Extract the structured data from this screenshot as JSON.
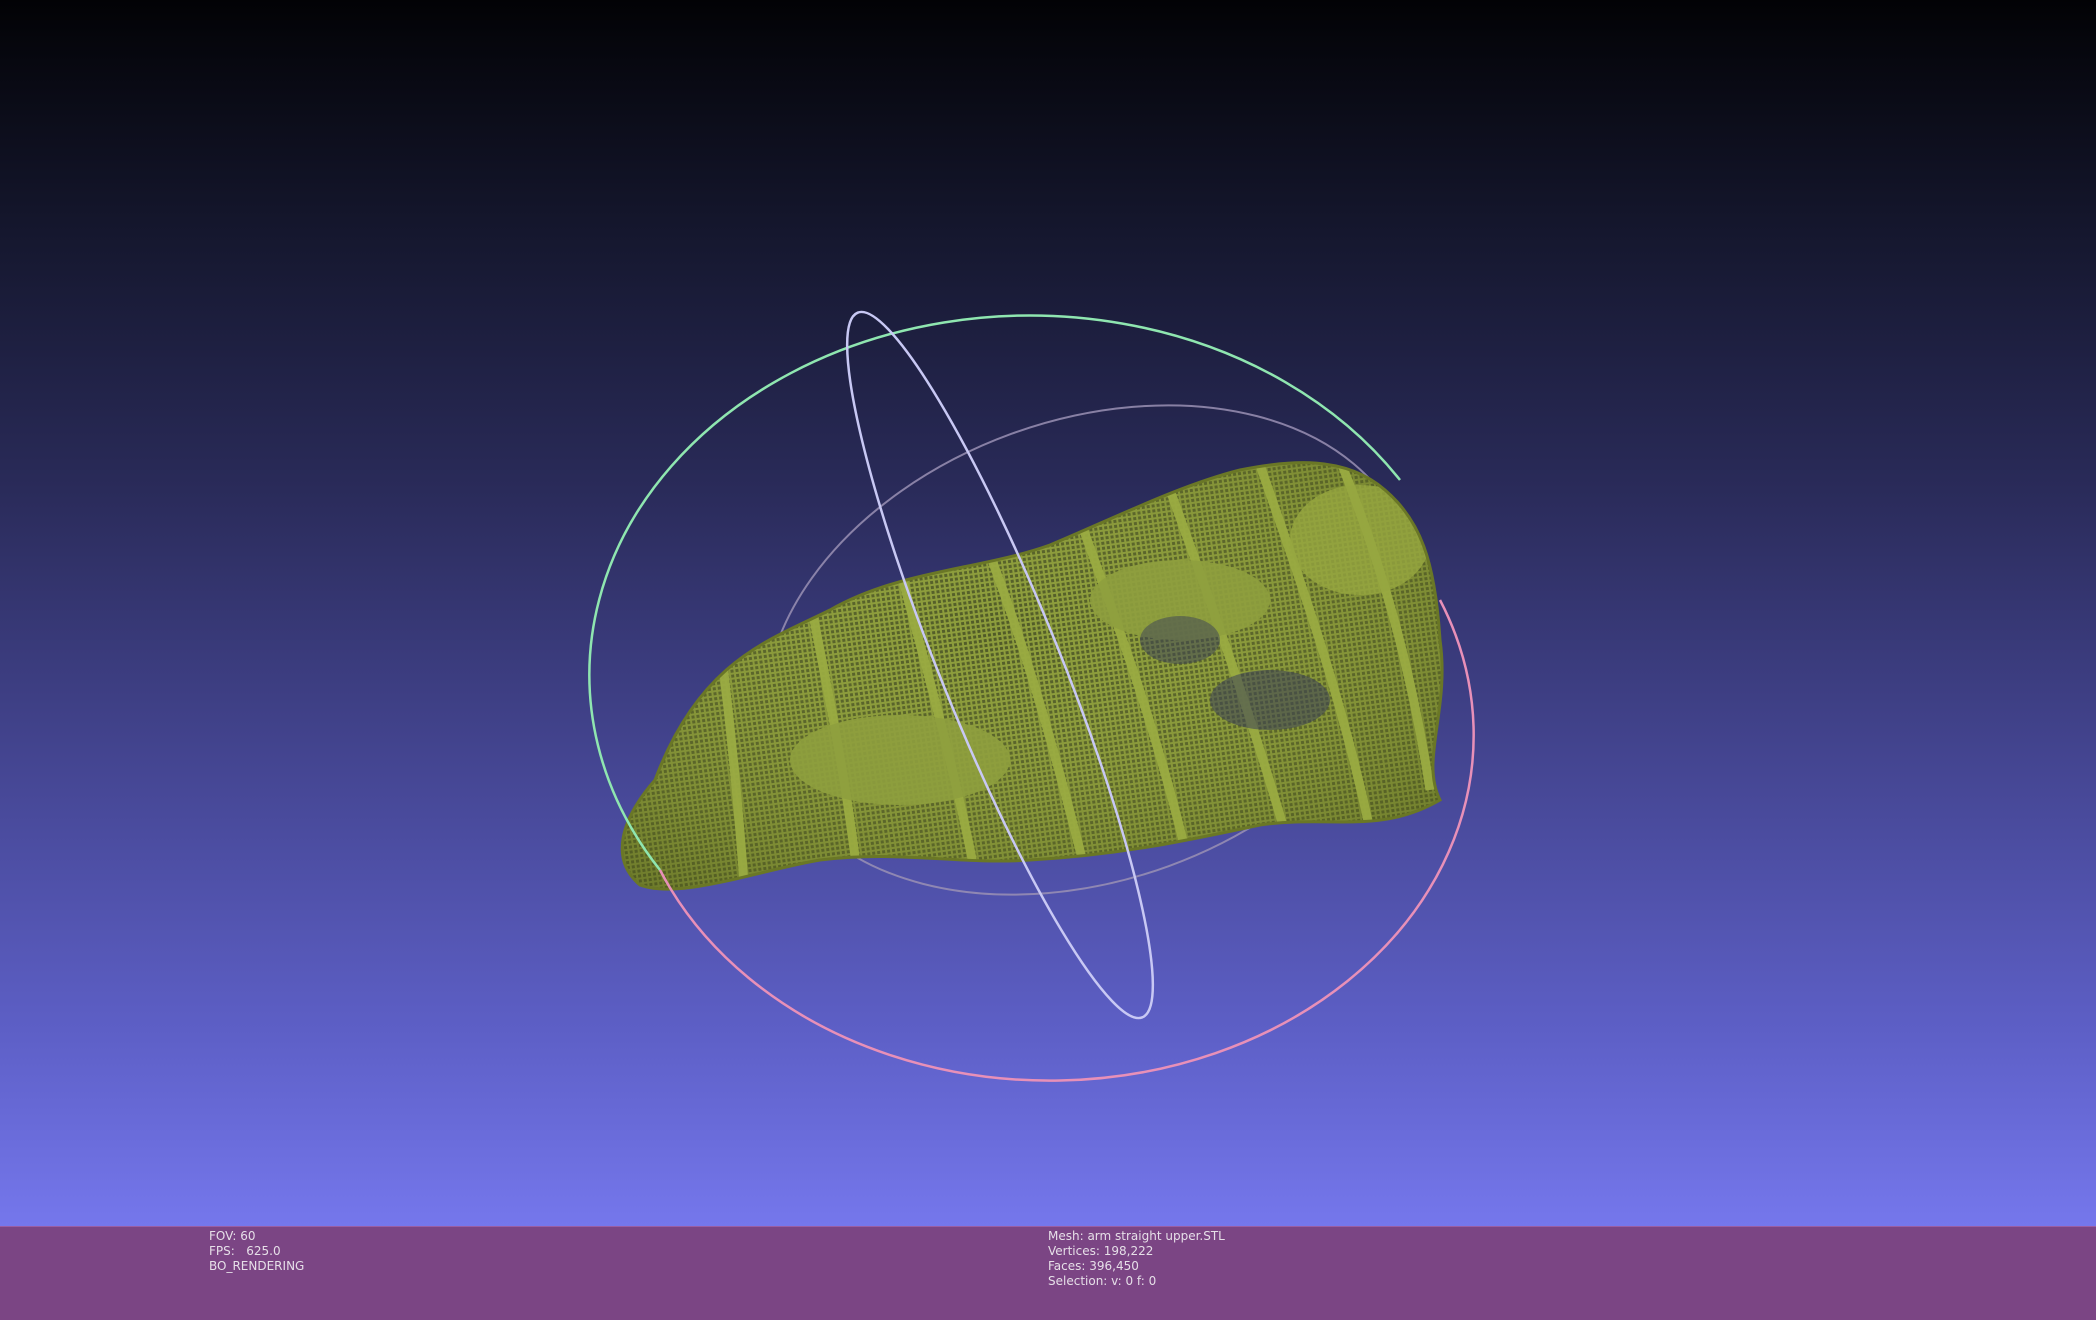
{
  "viewer": {
    "fov_line": "FOV: 60",
    "fps_line": "FPS:   625.0",
    "render_mode": "BO_RENDERING"
  },
  "mesh_info": {
    "mesh_line": "Mesh: arm straight upper.STL",
    "vertices_line": "Vertices: 198,222",
    "faces_line": "Faces: 396,450",
    "selection_line": "Selection: v: 0 f: 0"
  },
  "colors": {
    "background_top": "#020205",
    "background_bottom": "#7577ec",
    "mesh": "#8a9a3a",
    "statusbar": "#7b4584",
    "trackball_green": "#8fe6b0",
    "trackball_pink": "#e890b8",
    "trackball_blue": "#b8b8f0"
  }
}
